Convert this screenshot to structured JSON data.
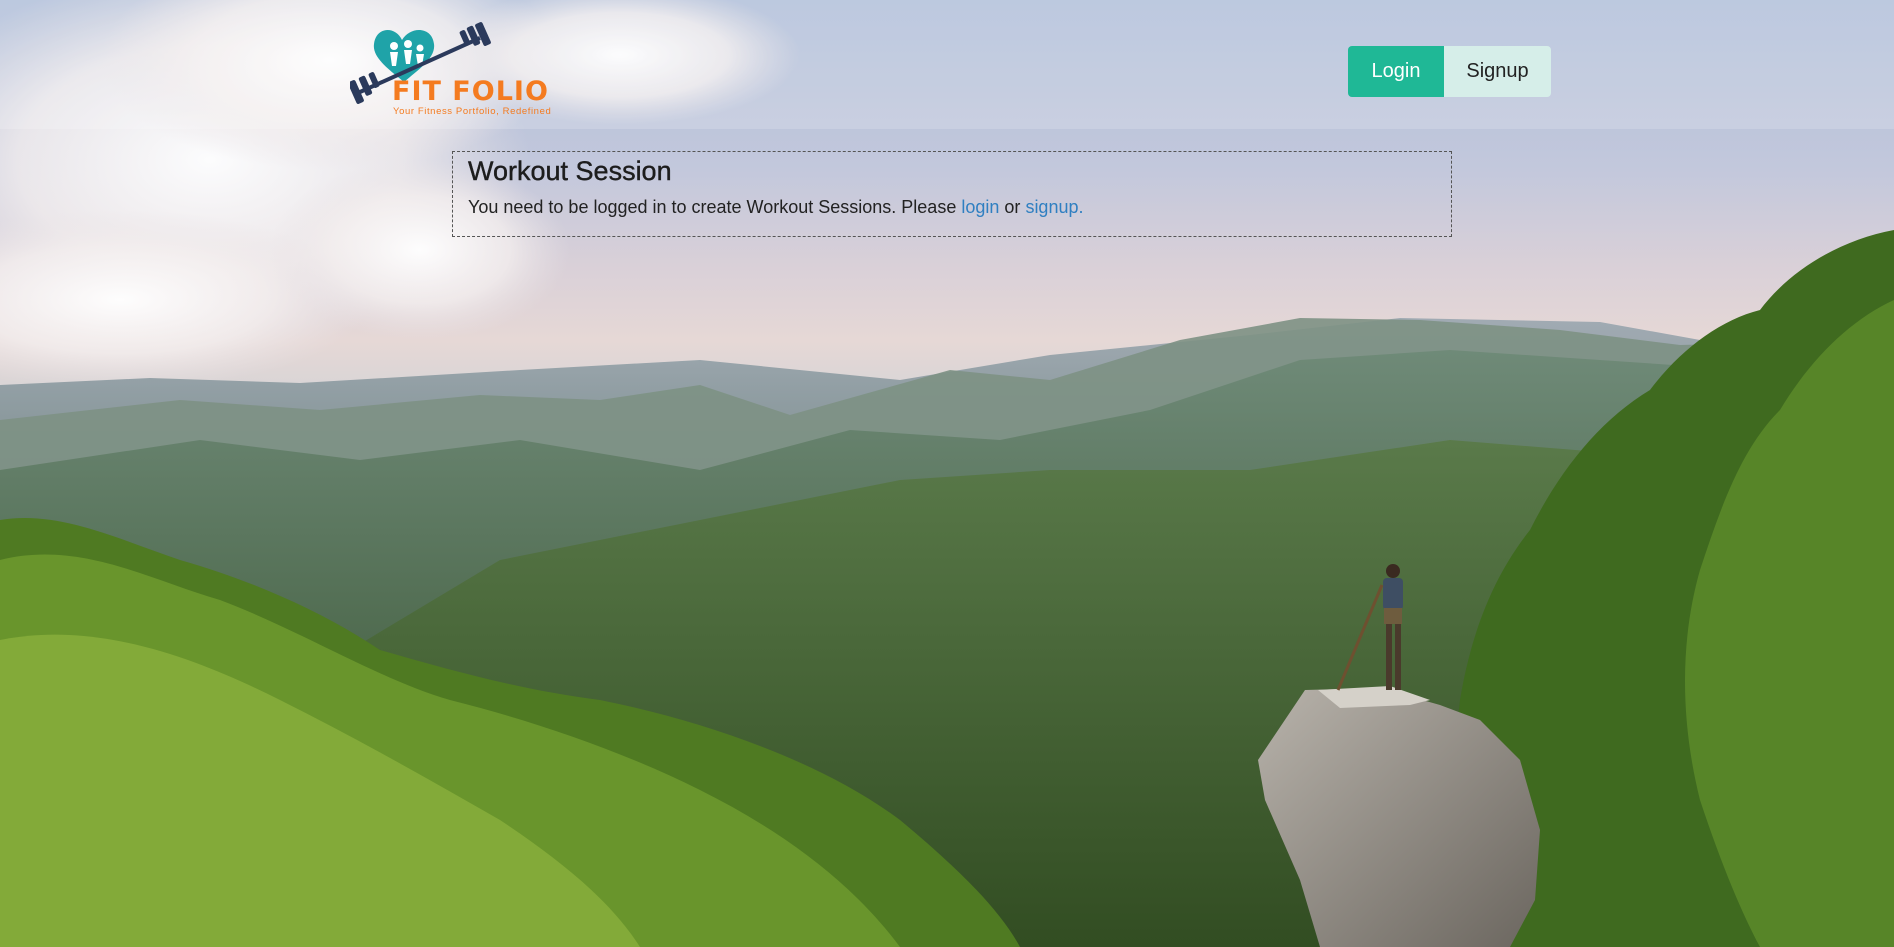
{
  "brand": {
    "name": "FIT FOLIO",
    "tagline": "Your Fitness Portfolio, Redefined",
    "colors": {
      "orange": "#f47b20",
      "teal": "#1fa3a8"
    }
  },
  "nav": {
    "login_label": "Login",
    "signup_label": "Signup",
    "login_color": "#1fb896",
    "signup_color": "#d6eee9"
  },
  "card": {
    "title": "Workout Session",
    "message_prefix": "You need to be logged in to create Workout Sessions. Please",
    "login_link": "login",
    "connector": "or",
    "signup_link": "signup."
  },
  "icons": {
    "logo": "dumbbell-heart-logo-icon"
  }
}
